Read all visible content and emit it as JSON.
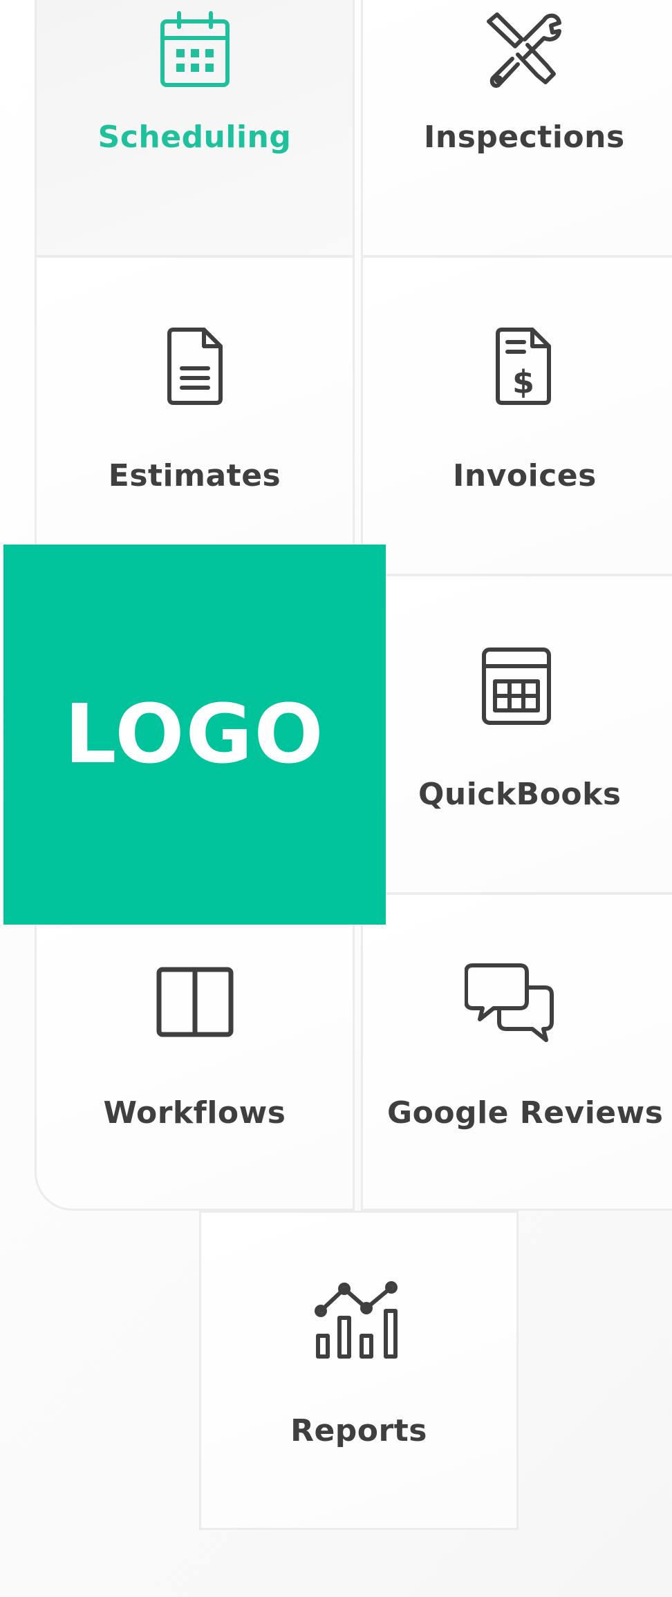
{
  "features": [
    {
      "id": "scheduling",
      "label": "Scheduling",
      "icon": "calendar-icon",
      "active": true
    },
    {
      "id": "inspections",
      "label": "Inspections",
      "icon": "wrench-screwdriver-icon",
      "active": false
    },
    {
      "id": "estimates",
      "label": "Estimates",
      "icon": "document-icon",
      "active": false
    },
    {
      "id": "invoices",
      "label": "Invoices",
      "icon": "invoice-dollar-icon",
      "active": false
    },
    {
      "id": "quickbooks",
      "label": "QuickBooks",
      "icon": "calculator-icon",
      "active": false
    },
    {
      "id": "workflows",
      "label": "Workflows",
      "icon": "columns-icon",
      "active": false
    },
    {
      "id": "google-reviews",
      "label": "Google Reviews",
      "icon": "chat-bubbles-icon",
      "active": false
    },
    {
      "id": "reports",
      "label": "Reports",
      "icon": "bar-line-chart-icon",
      "active": false
    }
  ],
  "logo": {
    "text": "LOGO"
  },
  "colors": {
    "accent": "#1fc09c",
    "logo_background": "#00c39c",
    "text": "#3f3f3f",
    "icon": "#3f3f3f",
    "border": "#ececec"
  }
}
